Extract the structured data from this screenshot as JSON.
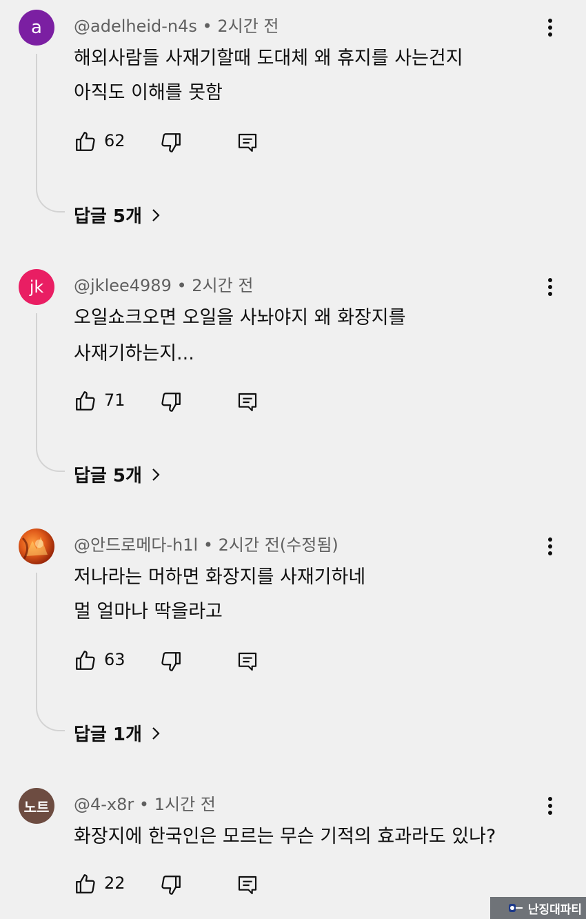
{
  "comments": [
    {
      "avatar_text": "a",
      "avatar_color": "#7b1fa2",
      "author": "@adelheid-n4s",
      "time": "2시간 전",
      "lines": [
        "해외사람들 사재기할때 도대체 왜 휴지를 사는건지",
        "아직도 이해를 못함"
      ],
      "likes": "62",
      "replies": "답글 5개"
    },
    {
      "avatar_text": "jk",
      "avatar_color": "#e91e63",
      "author": "@jklee4989",
      "time": "2시간 전",
      "lines": [
        "오일쇼크오면 오일을 사놔야지 왜 화장지를",
        "사재기하는지..."
      ],
      "likes": "71",
      "replies": "답글 5개"
    },
    {
      "avatar_text": "",
      "avatar_color": "#e05a1a",
      "author": "@안드로메다-h1l",
      "time": "2시간 전(수정됨)",
      "lines": [
        "저나라는 머하면 화장지를 사재기하네",
        "멀 얼마나 딱을라고"
      ],
      "likes": "63",
      "replies": "답글 1개"
    },
    {
      "avatar_text": "노트",
      "avatar_color": "#6d4c41",
      "author": "@4-x8r",
      "time": "1시간 전",
      "lines": [
        "화장지에 한국인은 모르는 무슨 기적의 효과라도 있나?"
      ],
      "likes": "22"
    }
  ],
  "separator": "•",
  "icons": {
    "like": "thumbs-up-icon",
    "dislike": "thumbs-down-icon",
    "reply": "reply-icon",
    "menu": "more-vert-icon",
    "chevron": "chevron-right-icon"
  },
  "watermark": "난징대파티"
}
